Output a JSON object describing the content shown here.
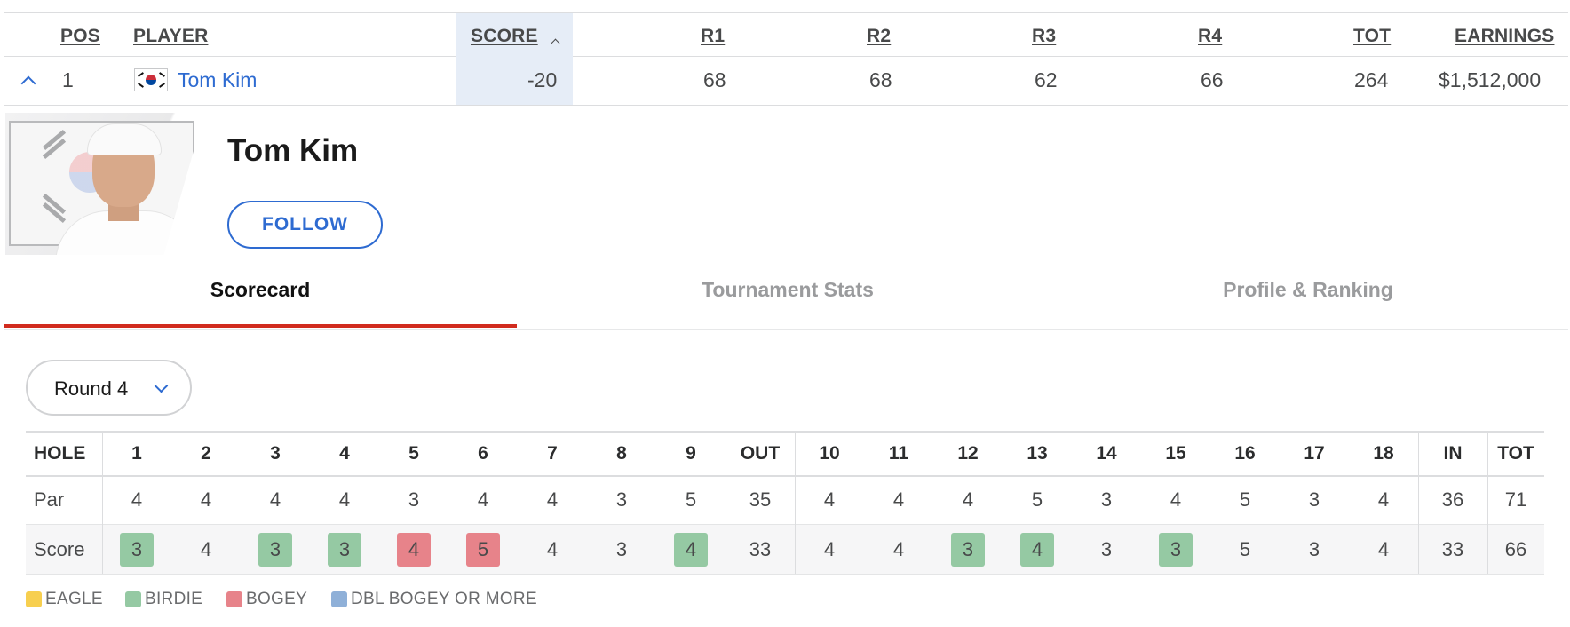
{
  "leaderboard": {
    "headers": {
      "pos": "POS",
      "player": "PLAYER",
      "score": "SCORE",
      "r1": "R1",
      "r2": "R2",
      "r3": "R3",
      "r4": "R4",
      "tot": "TOT",
      "earnings": "EARNINGS"
    },
    "row": {
      "pos": "1",
      "player": "Tom Kim",
      "score": "-20",
      "r1": "68",
      "r2": "68",
      "r3": "62",
      "r4": "66",
      "tot": "264",
      "earnings": "$1,512,000"
    }
  },
  "player_card": {
    "name": "Tom Kim",
    "follow_label": "FOLLOW"
  },
  "tabs": [
    {
      "label": "Scorecard",
      "active": true
    },
    {
      "label": "Tournament Stats",
      "active": false
    },
    {
      "label": "Profile & Ranking",
      "active": false
    }
  ],
  "round_select": {
    "value": "Round 4"
  },
  "scorecard": {
    "header": [
      "HOLE",
      "1",
      "2",
      "3",
      "4",
      "5",
      "6",
      "7",
      "8",
      "9",
      "OUT",
      "10",
      "11",
      "12",
      "13",
      "14",
      "15",
      "16",
      "17",
      "18",
      "IN",
      "TOT"
    ],
    "par": [
      "Par",
      "4",
      "4",
      "4",
      "4",
      "3",
      "4",
      "4",
      "3",
      "5",
      "35",
      "4",
      "4",
      "4",
      "5",
      "3",
      "4",
      "5",
      "3",
      "4",
      "36",
      "71"
    ],
    "score": [
      "Score",
      "3",
      "4",
      "3",
      "3",
      "4",
      "5",
      "4",
      "3",
      "4",
      "33",
      "4",
      "4",
      "3",
      "4",
      "3",
      "3",
      "5",
      "3",
      "4",
      "33",
      "66"
    ],
    "score_types": [
      "",
      "birdie",
      "",
      "birdie",
      "birdie",
      "bogey",
      "bogey",
      "",
      "",
      "birdie",
      "",
      "",
      "",
      "birdie",
      "birdie",
      "",
      "birdie",
      "",
      "",
      "",
      "",
      ""
    ]
  },
  "legend": [
    {
      "label": "EAGLE",
      "color": "#f7cf4f"
    },
    {
      "label": "BIRDIE",
      "color": "#95c9a3"
    },
    {
      "label": "BOGEY",
      "color": "#e7838a"
    },
    {
      "label": "DBL BOGEY OR MORE",
      "color": "#8fb0d8"
    }
  ]
}
